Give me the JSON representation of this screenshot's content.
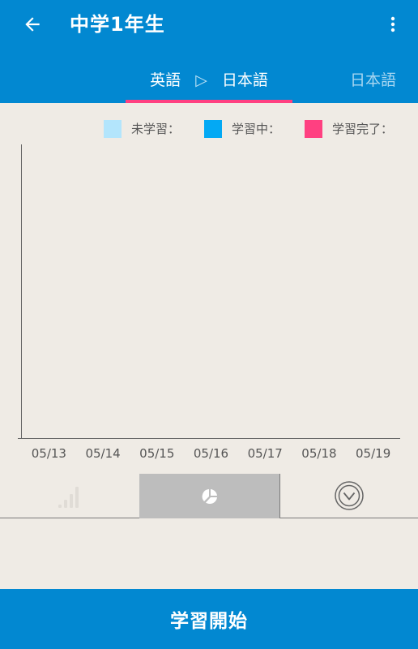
{
  "appbar": {
    "title": "中学1年生",
    "back_icon": "arrow-left-icon",
    "more_icon": "more-vert-icon"
  },
  "tabs": {
    "active": {
      "from": "英語",
      "arrow": "▷",
      "to": "日本語"
    },
    "next": "日本語"
  },
  "legend": [
    {
      "label": "未学習：",
      "color": "#b3e5fc"
    },
    {
      "label": "学習中：",
      "color": "#03a9f4"
    },
    {
      "label": "学習完了：",
      "color": "#ff4081"
    }
  ],
  "chart_data": {
    "type": "bar",
    "categories": [
      "05/13",
      "05/14",
      "05/15",
      "05/16",
      "05/17",
      "05/18",
      "05/19"
    ],
    "series": [
      {
        "name": "未学習",
        "values": [
          0,
          0,
          0,
          0,
          0,
          0,
          0
        ]
      },
      {
        "name": "学習中",
        "values": [
          0,
          0,
          0,
          0,
          0,
          0,
          0
        ]
      },
      {
        "name": "学習完了",
        "values": [
          0,
          0,
          0,
          0,
          0,
          0,
          0
        ]
      }
    ],
    "stacked": true,
    "ylim": [
      0,
      1
    ],
    "grid": false,
    "legend": "top-right",
    "title": "",
    "xlabel": "",
    "ylabel": ""
  },
  "panel_tabs": [
    {
      "icon": "bar-signal-icon",
      "selected": false
    },
    {
      "icon": "pie-chart-icon",
      "selected": true
    },
    {
      "icon": "circle-chevron-down-icon",
      "selected": false
    }
  ],
  "start_button": {
    "label": "学習開始"
  },
  "colors": {
    "primary": "#0288d1",
    "accent": "#ff4081",
    "background": "#efebe5"
  }
}
